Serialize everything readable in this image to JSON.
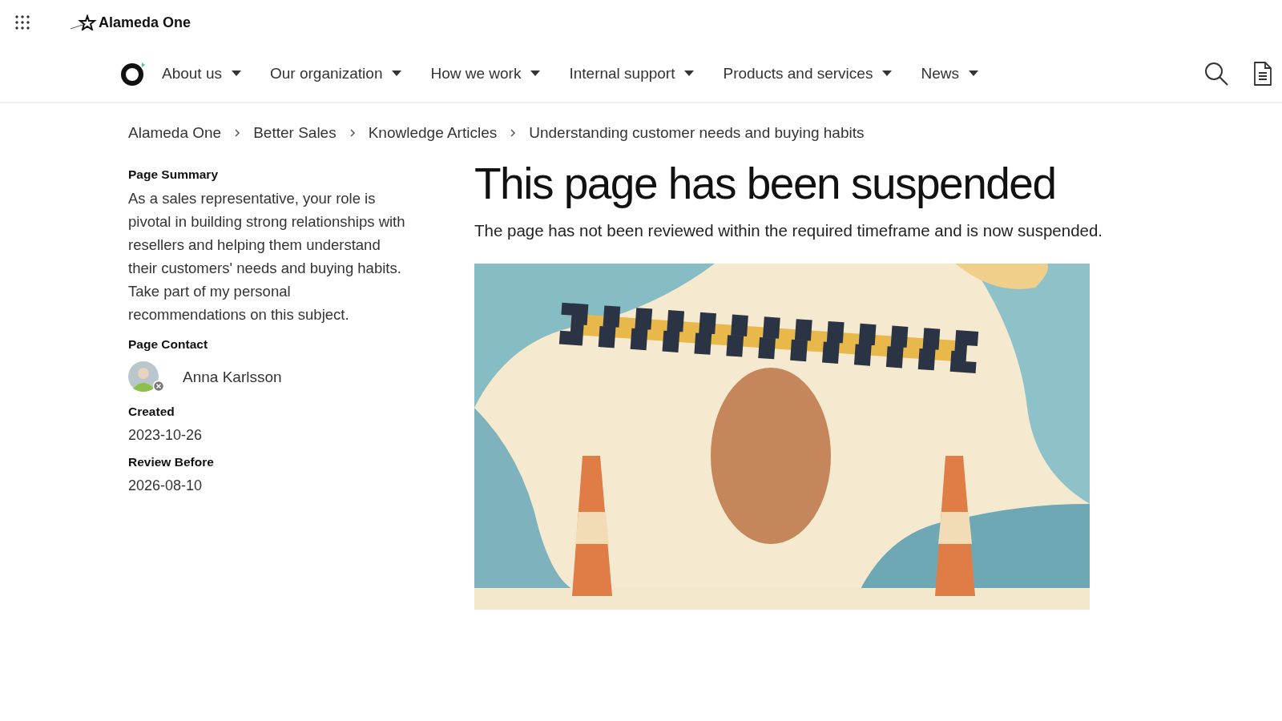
{
  "header": {
    "site_name": "Alameda One"
  },
  "nav": {
    "items": [
      {
        "label": "About us"
      },
      {
        "label": "Our organization"
      },
      {
        "label": "How we work"
      },
      {
        "label": "Internal support"
      },
      {
        "label": "Products and services"
      },
      {
        "label": "News"
      }
    ]
  },
  "breadcrumbs": [
    "Alameda One",
    "Better Sales",
    "Knowledge Articles",
    "Understanding customer needs and buying habits"
  ],
  "sidebar": {
    "summary_heading": "Page Summary",
    "summary": "As a sales representative, your role is pivotal in building strong relationships with resellers and helping them understand their customers' needs and buying habits. Take part of my personal recommendations on this subject.",
    "contact_heading": "Page Contact",
    "contact_name": "Anna Karlsson",
    "created_heading": "Created",
    "created": "2023-10-26",
    "review_heading": "Review Before",
    "review": "2026-08-10"
  },
  "main": {
    "title": "This page has been suspended",
    "message": "The page has not been reviewed within the required timeframe and is now suspended."
  }
}
